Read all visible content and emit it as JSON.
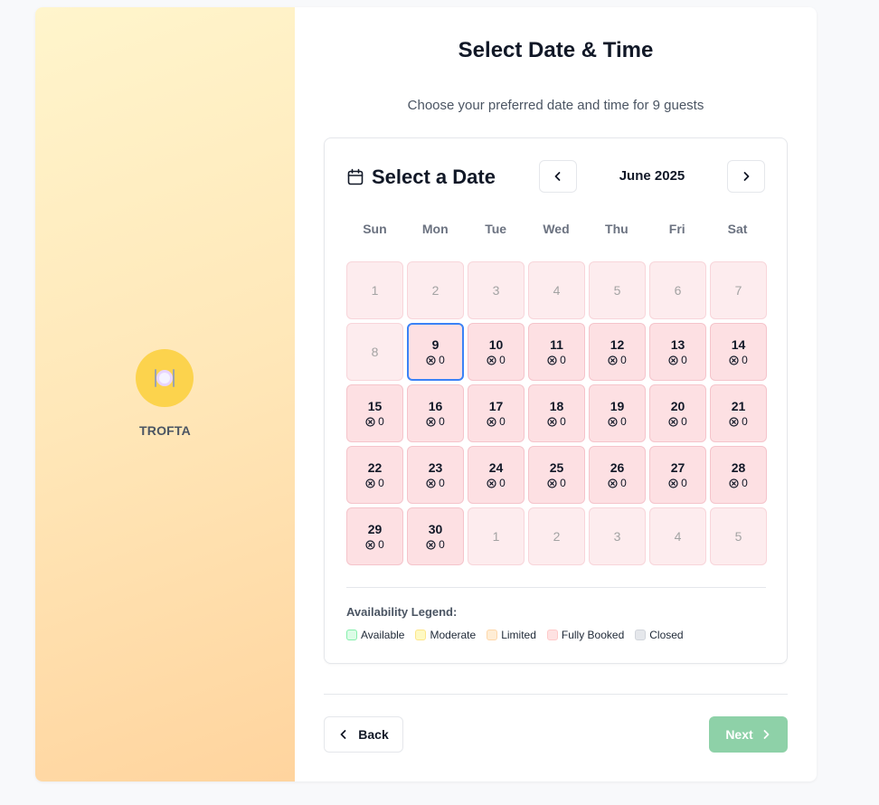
{
  "brand": {
    "name": "TROFTA",
    "icon": "plate-cutlery-icon"
  },
  "header": {
    "title": "Select Date & Time",
    "subtitle": "Choose your preferred date and time for 9 guests"
  },
  "calendar": {
    "heading": "Select a Date",
    "month_label": "June 2025",
    "weekdays": [
      "Sun",
      "Mon",
      "Tue",
      "Wed",
      "Thu",
      "Fri",
      "Sat"
    ],
    "days": [
      {
        "label": "1",
        "state": "past"
      },
      {
        "label": "2",
        "state": "past"
      },
      {
        "label": "3",
        "state": "past"
      },
      {
        "label": "4",
        "state": "past"
      },
      {
        "label": "5",
        "state": "past"
      },
      {
        "label": "6",
        "state": "past"
      },
      {
        "label": "7",
        "state": "past"
      },
      {
        "label": "8",
        "state": "past"
      },
      {
        "label": "9",
        "state": "booked",
        "count": "0",
        "selected": true
      },
      {
        "label": "10",
        "state": "booked",
        "count": "0"
      },
      {
        "label": "11",
        "state": "booked",
        "count": "0"
      },
      {
        "label": "12",
        "state": "booked",
        "count": "0"
      },
      {
        "label": "13",
        "state": "booked",
        "count": "0"
      },
      {
        "label": "14",
        "state": "booked",
        "count": "0"
      },
      {
        "label": "15",
        "state": "booked",
        "count": "0"
      },
      {
        "label": "16",
        "state": "booked",
        "count": "0"
      },
      {
        "label": "17",
        "state": "booked",
        "count": "0"
      },
      {
        "label": "18",
        "state": "booked",
        "count": "0"
      },
      {
        "label": "19",
        "state": "booked",
        "count": "0"
      },
      {
        "label": "20",
        "state": "booked",
        "count": "0"
      },
      {
        "label": "21",
        "state": "booked",
        "count": "0"
      },
      {
        "label": "22",
        "state": "booked",
        "count": "0"
      },
      {
        "label": "23",
        "state": "booked",
        "count": "0"
      },
      {
        "label": "24",
        "state": "booked",
        "count": "0"
      },
      {
        "label": "25",
        "state": "booked",
        "count": "0"
      },
      {
        "label": "26",
        "state": "booked",
        "count": "0"
      },
      {
        "label": "27",
        "state": "booked",
        "count": "0"
      },
      {
        "label": "28",
        "state": "booked",
        "count": "0"
      },
      {
        "label": "29",
        "state": "booked",
        "count": "0"
      },
      {
        "label": "30",
        "state": "booked",
        "count": "0"
      },
      {
        "label": "1",
        "state": "next-month"
      },
      {
        "label": "2",
        "state": "next-month"
      },
      {
        "label": "3",
        "state": "next-month"
      },
      {
        "label": "4",
        "state": "next-month"
      },
      {
        "label": "5",
        "state": "next-month"
      }
    ],
    "legend_title": "Availability Legend:",
    "legend": [
      {
        "label": "Available",
        "color": "#dcfce7",
        "border": "#86efac"
      },
      {
        "label": "Moderate",
        "color": "#fef9c3",
        "border": "#fde68a"
      },
      {
        "label": "Limited",
        "color": "#ffedd5",
        "border": "#fed7aa"
      },
      {
        "label": "Fully Booked",
        "color": "#fee2e2",
        "border": "#fecaca"
      },
      {
        "label": "Closed",
        "color": "#e5e7eb",
        "border": "#d1d5db"
      }
    ]
  },
  "footer": {
    "back_label": "Back",
    "next_label": "Next"
  },
  "colors": {
    "accent": "#3b82f6",
    "next_button": "#8ed1a8",
    "brand_circle": "#fcd34d"
  }
}
